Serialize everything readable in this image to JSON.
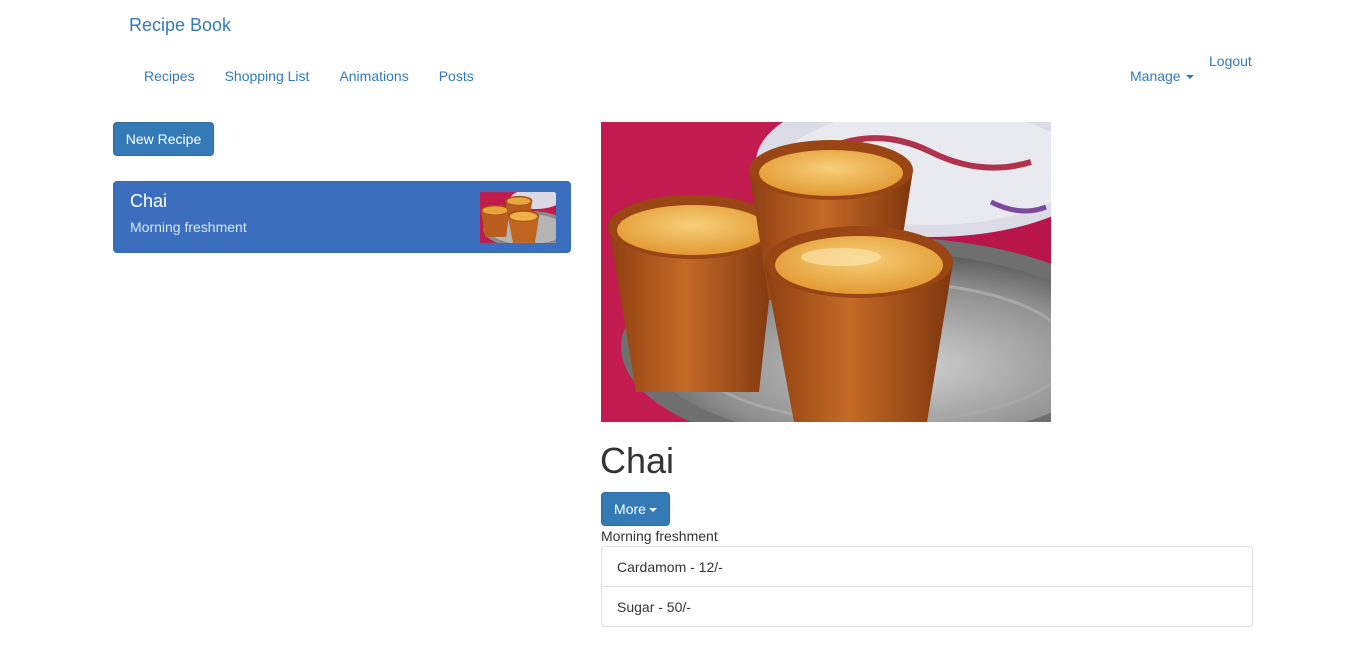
{
  "brand": "Recipe Book",
  "nav": {
    "items": [
      {
        "label": "Recipes"
      },
      {
        "label": "Shopping List"
      },
      {
        "label": "Animations"
      },
      {
        "label": "Posts"
      }
    ],
    "manage": "Manage",
    "logout": "Logout"
  },
  "sidebar": {
    "new_recipe": "New Recipe",
    "recipes": [
      {
        "name": "Chai",
        "description": "Morning freshment"
      }
    ]
  },
  "detail": {
    "title": "Chai",
    "more_label": "More",
    "description": "Morning freshment",
    "ingredients": [
      {
        "text": "Cardamom - 12/-"
      },
      {
        "text": "Sugar - 50/-"
      }
    ]
  },
  "colors": {
    "link": "#337ab7",
    "primary": "#337ab7",
    "active_item": "#3b6fbd"
  }
}
